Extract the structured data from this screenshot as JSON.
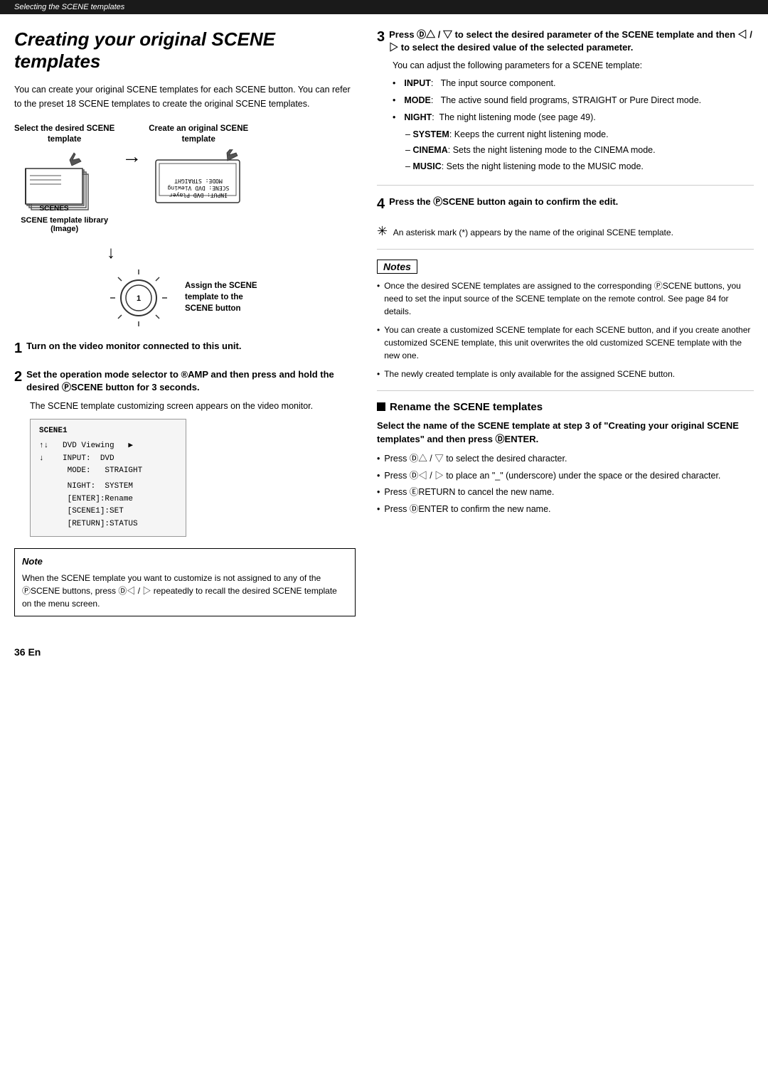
{
  "breadcrumb": "Selecting the SCENE templates",
  "title": "Creating your original SCENE templates",
  "intro": "You can create your original SCENE templates for each SCENE button. You can refer to the preset 18 SCENE templates to create the original SCENE templates.",
  "diagram": {
    "left_label_line1": "Select the desired SCENE",
    "left_label_line2": "template",
    "right_label_line1": "Create an original SCENE",
    "right_label_line2": "template",
    "bottom_label_line1": "Assign the SCENE",
    "bottom_label_line2": "template to the",
    "bottom_label_line3": "SCENE button",
    "library_label_line1": "SCENE template library",
    "library_label_line2": "(Image)"
  },
  "steps_left": [
    {
      "number": "1",
      "title": "Turn on the video monitor connected to this unit."
    },
    {
      "number": "2",
      "title": "Set the operation mode selector to ®AMP and then press and hold the desired ⓅSCENE button for 3 seconds.",
      "body": "The SCENE template customizing screen appears on the video monitor."
    }
  ],
  "note_left": {
    "title": "Note",
    "body": "When the SCENE template you want to customize is not assigned to any of the ⓅSCENE buttons, press Ⓓ◁ / ▷ repeatedly to recall the desired SCENE template on the menu screen."
  },
  "screen_content": "SCENE1\n\n↑↓   DVD Viewing    ▶\n↓    INPUT:  DVD\n     MODE:   STRAIGHT\n\n     NIGHT:  SYSTEM\n     [ENTER]:Rename\n     [SCENE1]:SET\n     [RETURN]:STATUS",
  "steps_right": [
    {
      "number": "3",
      "title": "Press Ⓓ△ / ▽ to select the desired parameter of the SCENE template and then ◁ / ▷ to select the desired value of the selected parameter.",
      "body": "You can adjust the following parameters for a SCENE template:"
    }
  ],
  "parameters": [
    {
      "label": "INPUT",
      "text": "The input source component."
    },
    {
      "label": "MODE",
      "text": "The active sound field programs, STRAIGHT or Pure Direct mode."
    },
    {
      "label": "NIGHT",
      "text": "The night listening mode (see page 49)."
    }
  ],
  "sub_parameters": [
    {
      "label": "SYSTEM",
      "text": "Keeps the current night listening mode."
    },
    {
      "label": "CINEMA",
      "text": "Sets the night listening mode to the CINEMA mode."
    },
    {
      "label": "MUSIC",
      "text": "Sets the night listening mode to the MUSIC mode."
    }
  ],
  "step4": {
    "number": "4",
    "title": "Press the ⓅSCENE button again to confirm the edit."
  },
  "asterisk_note": "An asterisk mark (*) appears by the name of the original SCENE template.",
  "notes_title": "Notes",
  "notes": [
    "Once the desired SCENE templates are assigned to the corresponding ⓅSCENE buttons, you need to set the input source of the SCENE template on the remote control. See page 84 for details.",
    "You can create a customized SCENE template for each SCENE button, and if you create another customized SCENE template, this unit overwrites the old customized SCENE template with the new one.",
    "The newly created template is only available for the assigned SCENE button."
  ],
  "rename_section": {
    "title": "Rename the SCENE templates",
    "step_title": "Select the name of the SCENE template at step 3 of \"Creating your original SCENE templates\" and then press ⒹENTER.",
    "bullets": [
      "Press Ⓓ△ / ▽ to select the desired character.",
      "Press Ⓓ◁ / ▷ to place an \"_\" (underscore) under the space or the desired character.",
      "Press ⒺRETURN to cancel the new name.",
      "Press ⒹENTER to confirm the new name."
    ]
  },
  "page_number": "36 En"
}
